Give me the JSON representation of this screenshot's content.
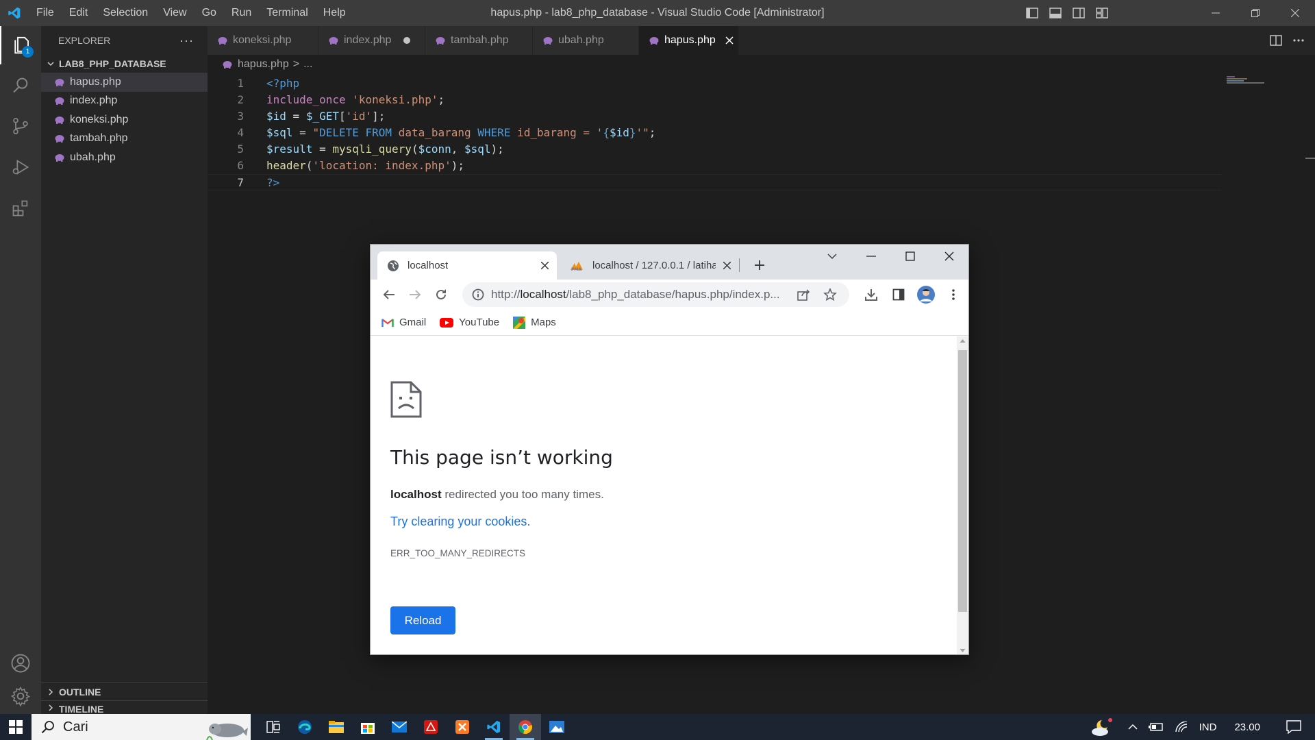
{
  "window": {
    "title": "hapus.php - lab8_php_database - Visual Studio Code [Administrator]"
  },
  "menu": [
    "File",
    "Edit",
    "Selection",
    "View",
    "Go",
    "Run",
    "Terminal",
    "Help"
  ],
  "activity": {
    "explorer_badge": "1"
  },
  "sidebar": {
    "title": "EXPLORER",
    "more": "···",
    "folder": "LAB8_PHP_DATABASE",
    "files": [
      "hapus.php",
      "index.php",
      "koneksi.php",
      "tambah.php",
      "ubah.php"
    ],
    "sections": [
      "OUTLINE",
      "TIMELINE"
    ]
  },
  "tabs": [
    {
      "label": "koneksi.php"
    },
    {
      "label": "index.php"
    },
    {
      "label": "tambah.php"
    },
    {
      "label": "ubah.php"
    },
    {
      "label": "hapus.php"
    }
  ],
  "breadcrumb": {
    "file": "hapus.php",
    "sep": ">",
    "rest": "..."
  },
  "editor": {
    "line_numbers": [
      "1",
      "2",
      "3",
      "4",
      "5",
      "6",
      "7"
    ],
    "lines": [
      [
        {
          "t": "<?php",
          "c": "kw"
        }
      ],
      [
        {
          "t": "include_once",
          "c": "tag"
        },
        {
          "t": " ",
          "c": "plain"
        },
        {
          "t": "'koneksi.php'",
          "c": "str"
        },
        {
          "t": ";",
          "c": "plain"
        }
      ],
      [
        {
          "t": "$id",
          "c": "var"
        },
        {
          "t": " = ",
          "c": "plain"
        },
        {
          "t": "$_GET",
          "c": "var"
        },
        {
          "t": "[",
          "c": "plain"
        },
        {
          "t": "'id'",
          "c": "str"
        },
        {
          "t": "];",
          "c": "plain"
        }
      ],
      [
        {
          "t": "$sql",
          "c": "var"
        },
        {
          "t": " = ",
          "c": "plain"
        },
        {
          "t": "\"",
          "c": "str"
        },
        {
          "t": "DELETE FROM",
          "c": "kw"
        },
        {
          "t": " data_barang ",
          "c": "str"
        },
        {
          "t": "WHERE",
          "c": "kw"
        },
        {
          "t": " id_barang = '",
          "c": "str"
        },
        {
          "t": "{",
          "c": "kw"
        },
        {
          "t": "$id",
          "c": "var"
        },
        {
          "t": "}",
          "c": "kw"
        },
        {
          "t": "'\"",
          "c": "str"
        },
        {
          "t": ";",
          "c": "plain"
        }
      ],
      [
        {
          "t": "$result",
          "c": "var"
        },
        {
          "t": " = ",
          "c": "plain"
        },
        {
          "t": "mysqli_query",
          "c": "fn"
        },
        {
          "t": "(",
          "c": "plain"
        },
        {
          "t": "$conn",
          "c": "var"
        },
        {
          "t": ", ",
          "c": "plain"
        },
        {
          "t": "$sql",
          "c": "var"
        },
        {
          "t": ");",
          "c": "plain"
        }
      ],
      [
        {
          "t": "header",
          "c": "fn"
        },
        {
          "t": "(",
          "c": "plain"
        },
        {
          "t": "'location: index.php'",
          "c": "str"
        },
        {
          "t": ");",
          "c": "plain"
        }
      ],
      [
        {
          "t": "?>",
          "c": "kw"
        }
      ]
    ]
  },
  "browser": {
    "tabs": [
      {
        "title": "localhost"
      },
      {
        "title": "localhost / 127.0.0.1 / latiha"
      }
    ],
    "url_scheme": "http://",
    "url_host": "localhost",
    "url_path": "/lab8_php_database/hapus.php/index.p...",
    "bookmarks": [
      "Gmail",
      "YouTube",
      "Maps"
    ],
    "error": {
      "heading": "This page isn’t working",
      "host": "localhost",
      "message": " redirected you too many times.",
      "suggestion": "Try clearing your cookies",
      "suggestion_end": ".",
      "code": "ERR_TOO_MANY_REDIRECTS",
      "button": "Reload"
    }
  },
  "taskbar": {
    "search_placeholder": "Cari",
    "language": "IND",
    "time": "23.00"
  },
  "colors": {
    "accent": "#007acc",
    "chrome_blue": "#1a73e8",
    "php_icon": "#a074c4"
  }
}
